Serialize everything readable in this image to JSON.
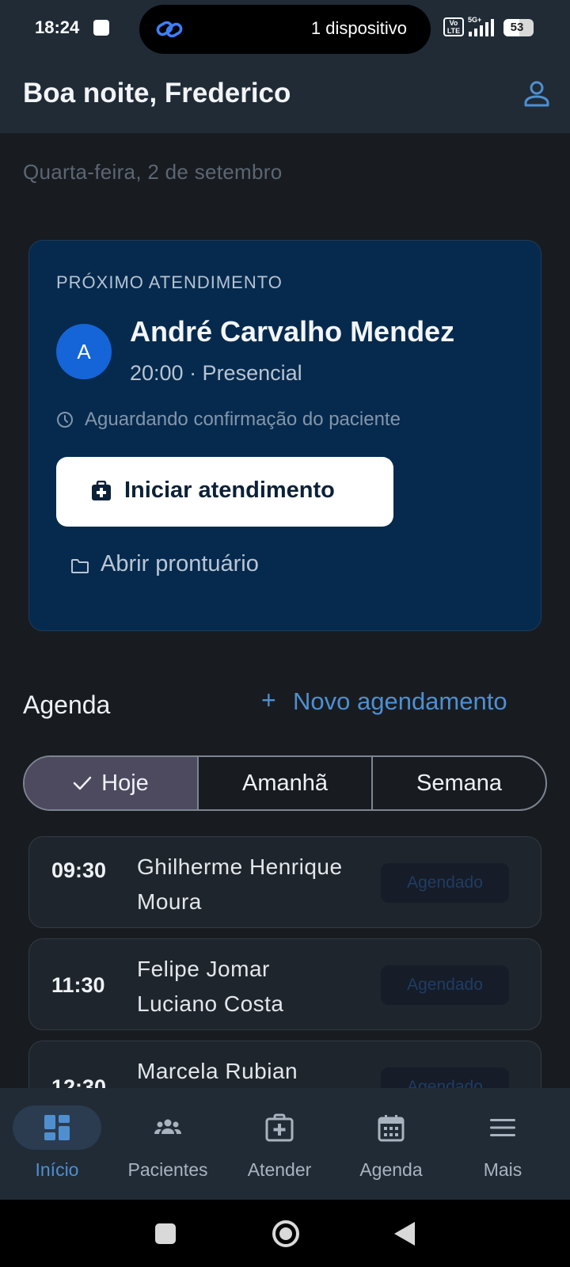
{
  "status_bar": {
    "time": "18:24",
    "island_text": "1 dispositivo",
    "network_badge": "VoLTE",
    "network_type": "5G+",
    "battery": "53"
  },
  "header": {
    "greeting": "Boa noite, Frederico",
    "profile_icon": "person-icon"
  },
  "date": "Quarta-feira, 2 de setembro",
  "next_appointment": {
    "kicker": "PRÓXIMO ATENDIMENTO",
    "avatar_initial": "A",
    "patient_name": "André Carvalho Mendez",
    "meta": "20:00 · Presencial",
    "status": "Aguardando confirmação do paciente",
    "start_button": "Iniciar atendimento",
    "open_record": "Abrir prontuário"
  },
  "agenda": {
    "title": "Agenda",
    "new_appointment": "Novo agendamento",
    "tabs": [
      {
        "label": "Hoje",
        "active": true
      },
      {
        "label": "Amanhã",
        "active": false
      },
      {
        "label": "Semana",
        "active": false
      }
    ],
    "items": [
      {
        "time": "09:30",
        "name": "Ghilherme Henrique Moura",
        "status": "Agendado"
      },
      {
        "time": "11:30",
        "name": "Felipe Jomar Luciano Costa",
        "status": "Agendado"
      },
      {
        "time": "12:30",
        "name": "Marcela Rubian",
        "status": "Agendado"
      }
    ]
  },
  "bottom_nav": [
    {
      "label": "Início",
      "icon": "dashboard-icon",
      "active": true
    },
    {
      "label": "Pacientes",
      "icon": "group-icon",
      "active": false
    },
    {
      "label": "Atender",
      "icon": "medical-kit-icon",
      "active": false
    },
    {
      "label": "Agenda",
      "icon": "calendar-icon",
      "active": false
    },
    {
      "label": "Mais",
      "icon": "menu-icon",
      "active": false
    }
  ],
  "colors": {
    "background": "#181c21",
    "header": "#202b36",
    "card": "#062a4d",
    "accent": "#4f8fd0",
    "avatar": "#1565d8",
    "active_tab": "#4d4a60"
  }
}
